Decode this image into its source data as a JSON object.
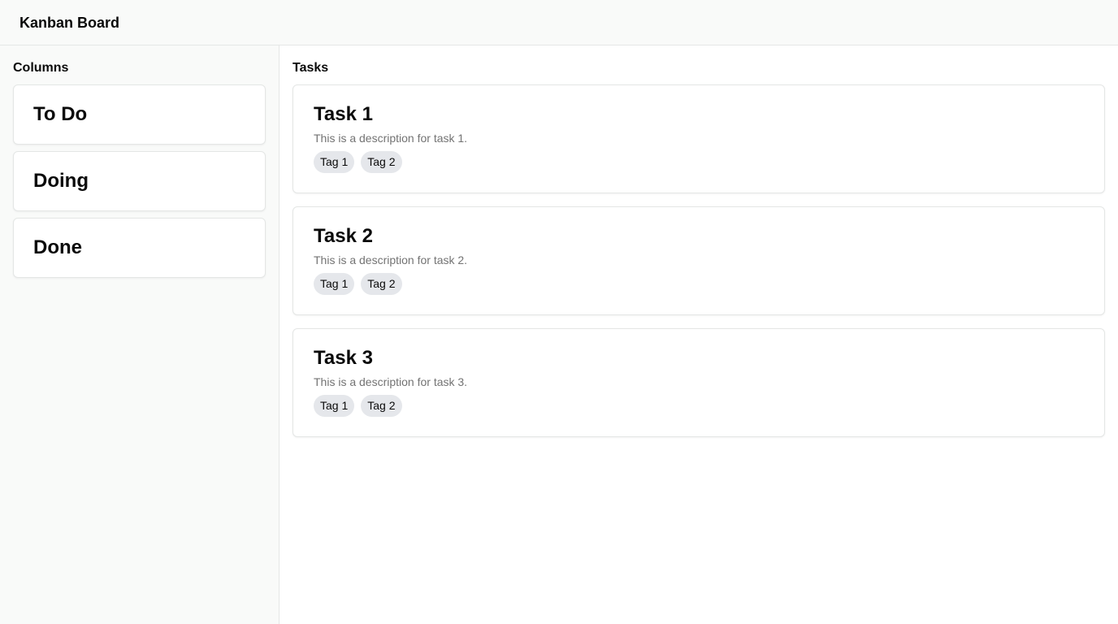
{
  "header": {
    "title": "Kanban Board"
  },
  "sidebar": {
    "heading": "Columns",
    "columns": [
      {
        "label": "To Do"
      },
      {
        "label": "Doing"
      },
      {
        "label": "Done"
      }
    ]
  },
  "main": {
    "heading": "Tasks",
    "tasks": [
      {
        "title": "Task 1",
        "description": "This is a description for task 1.",
        "tags": [
          "Tag 1",
          "Tag 2"
        ]
      },
      {
        "title": "Task 2",
        "description": "This is a description for task 2.",
        "tags": [
          "Tag 1",
          "Tag 2"
        ]
      },
      {
        "title": "Task 3",
        "description": "This is a description for task 3.",
        "tags": [
          "Tag 1",
          "Tag 2"
        ]
      }
    ]
  },
  "colors": {
    "header_bg": "#f9faf9",
    "tag_bg": "#e5e7eb",
    "description_text": "#737373",
    "border": "#e4e6e5"
  }
}
